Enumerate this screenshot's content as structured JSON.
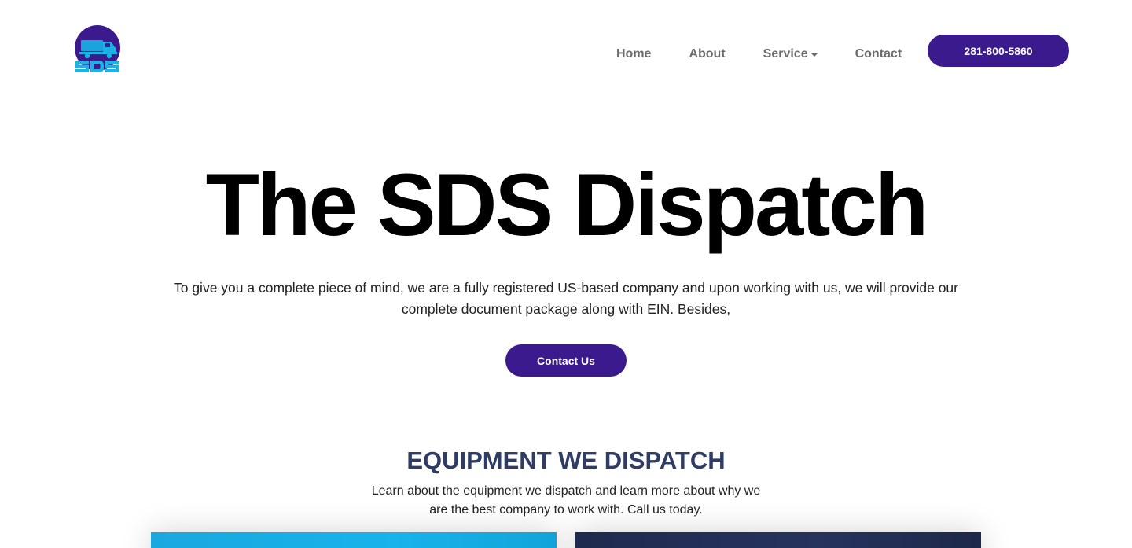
{
  "header": {
    "logo_alt": "SDS",
    "nav": [
      {
        "label": "Home"
      },
      {
        "label": "About"
      },
      {
        "label": "Service",
        "has_dropdown": true
      },
      {
        "label": "Contact"
      }
    ],
    "phone_label": "281-800-5860"
  },
  "hero": {
    "title": "The SDS Dispatch",
    "text": "To give you a complete piece of mind, we are a fully registered US-based company and upon working with us, we will provide our complete document package along with EIN. Besides,",
    "cta_label": "Contact Us"
  },
  "equipment": {
    "title": "EQUIPMENT WE DISPATCH",
    "subtitle": "Learn about the equipment we dispatch and learn more about why we are the best company to work with. Call us today."
  },
  "colors": {
    "brand": "#3a1a8c",
    "section_title": "#2f3d66",
    "logo_cyan": "#19b3e6"
  }
}
